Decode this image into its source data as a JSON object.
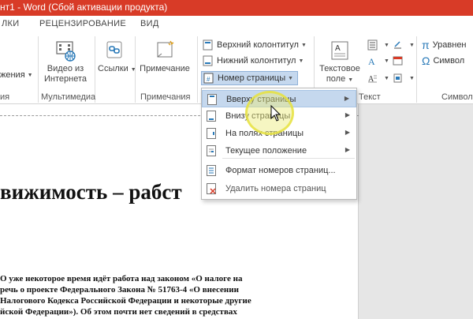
{
  "window": {
    "title": "нт1 - Word (Сбой активации продукта)"
  },
  "tabs": [
    "ЛКИ",
    "РЕЦЕНЗИРОВАНИЕ",
    "ВИД"
  ],
  "ribbon": {
    "buttons": {
      "partial_left": "жения",
      "video_line1": "Видео из",
      "video_line2": "Интернета",
      "links": "Ссылки",
      "comment": "Примечание",
      "textbox_line1": "Текстовое",
      "textbox_line2": "поле"
    },
    "header_footer": {
      "header": "Верхний колонтитул",
      "footer": "Нижний колонтитул",
      "page_number": "Номер страницы"
    },
    "right_group": {
      "equation": "Уравнен",
      "symbol": "Символ"
    },
    "group_labels": {
      "partial": "ия",
      "multimedia": "Мультимедиа",
      "comments": "Примечания",
      "text": "Текст",
      "symbols": "Символ"
    }
  },
  "menu": {
    "items": [
      {
        "label": "Вверху страницы",
        "submenu": true
      },
      {
        "label": "Внизу страницы",
        "submenu": true
      },
      {
        "label": "На полях страницы",
        "submenu": true
      },
      {
        "label": "Текущее положение",
        "submenu": true
      },
      {
        "label": "Формат номеров страниц...",
        "submenu": false
      },
      {
        "label": "Удалить номера страниц",
        "submenu": false
      }
    ]
  },
  "document": {
    "heading": "вижимость – рабст",
    "lines": [
      "О уже некоторое время идёт работа над законом «О налоге на",
      "речь о проекте Федерального Закона № 51763-4 «О внесении",
      "Налогового Кодекса Российской Федерации и некоторые другие",
      "йской Федерации»). Об этом почти нет сведений в средствах"
    ]
  },
  "colors": {
    "titlebar": "#d83b27",
    "highlight": "#c5d8ee"
  }
}
